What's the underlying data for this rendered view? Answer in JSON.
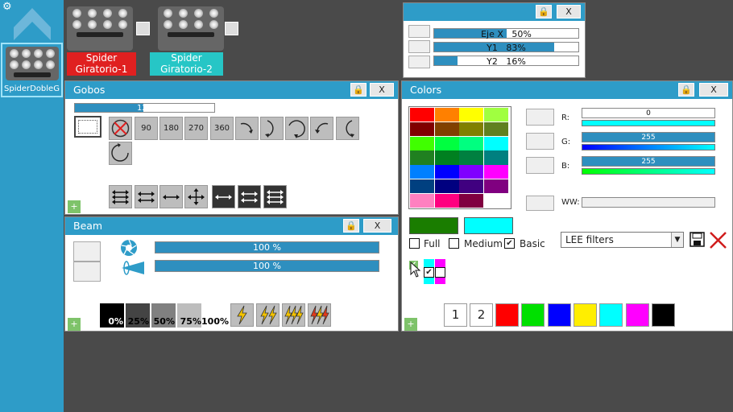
{
  "sidebar": {
    "device_label": "SpiderDobleG"
  },
  "fixtures": [
    {
      "name_line1": "Spider",
      "name_line2": "Giratorio-1",
      "color": "#e02020"
    },
    {
      "name_line1": "Spider",
      "name_line2": "Giratorio-2",
      "color": "#26c6c6"
    }
  ],
  "xy_panel": {
    "faders": [
      {
        "label": "Eje X",
        "value": "50%",
        "level": 0.5
      },
      {
        "label": "Y1",
        "value": "83%",
        "level": 0.83
      },
      {
        "label": "Y2",
        "value": "16%",
        "level": 0.16
      }
    ],
    "close_label": "X"
  },
  "gobos": {
    "title": "Gobos",
    "close_label": "X",
    "fader_value": "128",
    "fader_level": 0.49,
    "rotation_labels": [
      "90",
      "180",
      "270",
      "360"
    ],
    "plus_label": "+"
  },
  "beam": {
    "title": "Beam",
    "close_label": "X",
    "iris_value": "100 %",
    "iris_level": 1.0,
    "zoom_value": "100 %",
    "zoom_level": 1.0,
    "dimmer_labels": [
      "0%",
      "25%",
      "50%",
      "75%",
      "100%"
    ],
    "plus_label": "+"
  },
  "colors": {
    "title": "Colors",
    "close_label": "X",
    "r_label": "R:",
    "g_label": "G:",
    "b_label": "B:",
    "ww_label": "WW:",
    "r_value": "0",
    "g_value": "255",
    "b_value": "255",
    "r_level": 0.0,
    "g_level": 1.0,
    "b_level": 1.0,
    "mode_full": "Full",
    "mode_medium": "Medium",
    "mode_basic": "Basic",
    "filter_select": "LEE filters",
    "preset_numbers": [
      "1",
      "2"
    ],
    "preset_colors": [
      "#ff0000",
      "#00e000",
      "#0000ff",
      "#ffee00",
      "#00ffff",
      "#ff00ff",
      "#000000"
    ],
    "current_color_a": "#1a7d00",
    "current_color_b": "#00ffff",
    "grid": [
      [
        "#ff0000",
        "#ff8000",
        "#ffff00",
        "#a0ff40"
      ],
      [
        "#800000",
        "#804000",
        "#808000",
        "#608020"
      ],
      [
        "#40ff00",
        "#00ff40",
        "#00ff80",
        "#00ffff"
      ],
      [
        "#208020",
        "#008020",
        "#008040",
        "#008080"
      ],
      [
        "#0080ff",
        "#0000ff",
        "#8000ff",
        "#ff00ff"
      ],
      [
        "#004080",
        "#000080",
        "#400080",
        "#800080"
      ],
      [
        "#ff80c0",
        "#ff0080",
        "#800040",
        "#ffffff"
      ]
    ],
    "plus_label": "+"
  }
}
